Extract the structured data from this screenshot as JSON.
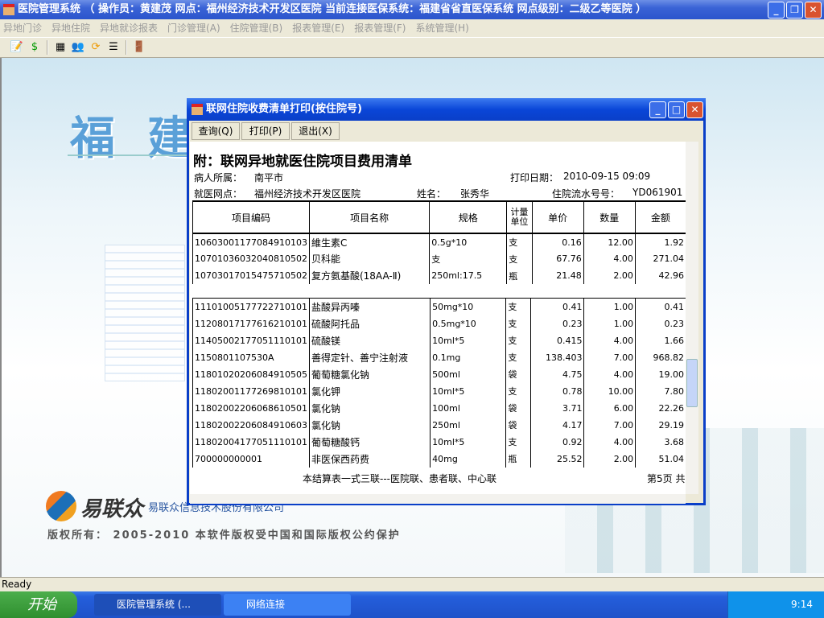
{
  "window": {
    "title": "医院管理系统 （ 操作员：黄建茂  网点：福州经济技术开发区医院    当前连接医保系统：福建省省直医保系统  网点级别：二级乙等医院 ）"
  },
  "menu": [
    "异地门诊",
    "异地住院",
    "异地就诊报表",
    "门诊管理(A)",
    "住院管理(B)",
    "报表管理(E)",
    "报表管理(F)",
    "系统管理(H)"
  ],
  "desktop": {
    "banner": "福建",
    "logo": "易联众",
    "company": "易联众信息技术股份有限公司",
    "copyright": "版权所有： 2005-2010 本软件版权受中国和国际版权公约保护"
  },
  "status": "Ready",
  "taskbar": {
    "start": "开始",
    "items": [
      "医院管理系统 (...",
      "网络连接"
    ],
    "clock": "9:14"
  },
  "dialog": {
    "title": "联网住院收费清单打印(按住院号)",
    "buttons": [
      "查询(Q)",
      "打印(P)",
      "退出(X)"
    ],
    "report": {
      "title": "附：联网异地就医住院项目费用清单",
      "patient_origin_label": "病人所属：",
      "patient_origin": "南平市",
      "print_date_label": "打印日期：",
      "print_date": "2010-09-15 09:09",
      "site_label": "就医网点：",
      "site": "福州经济技术开发区医院",
      "name_label": "姓名：",
      "name": "张秀华",
      "serial_label": "住院流水号号：",
      "serial": "YD061901",
      "columns": [
        "项目编码",
        "项目名称",
        "规格",
        "计量单位",
        "单价",
        "数量",
        "金额"
      ],
      "rows_a": [
        [
          "10603001177084910103",
          "維生素C",
          "0.5g*10",
          "支",
          "0.16",
          "12.00",
          "1.92"
        ],
        [
          "10701036032040810502",
          "贝科能",
          "支",
          "支",
          "67.76",
          "4.00",
          "271.04"
        ],
        [
          "10703017015475710502",
          "复方氨基酸(18AA-Ⅱ)",
          "250ml:17.5",
          "瓶",
          "21.48",
          "2.00",
          "42.96"
        ]
      ],
      "rows_b": [
        [
          "11101005177722710101",
          "盐酸异丙嗪",
          "50mg*10",
          "支",
          "0.41",
          "1.00",
          "0.41"
        ],
        [
          "11208017177616210101",
          "硫酸阿托品",
          "0.5mg*10",
          "支",
          "0.23",
          "1.00",
          "0.23"
        ],
        [
          "11405002177051110101",
          "硫酸镁",
          "10ml*5",
          "支",
          "0.415",
          "4.00",
          "1.66"
        ],
        [
          "1150801107530A",
          "善得定针、善宁注射液",
          "0.1mg",
          "支",
          "138.403",
          "7.00",
          "968.82"
        ],
        [
          "11801020206084910505",
          "葡萄糖氯化钠",
          "500ml",
          "袋",
          "4.75",
          "4.00",
          "19.00"
        ],
        [
          "11802001177269810101",
          "氯化钾",
          "10ml*5",
          "支",
          "0.78",
          "10.00",
          "7.80"
        ],
        [
          "11802002206068610501",
          "氯化钠",
          "100ml",
          "袋",
          "3.71",
          "6.00",
          "22.26"
        ],
        [
          "11802002206084910603",
          "氯化钠",
          "250ml",
          "袋",
          "4.17",
          "7.00",
          "29.19"
        ],
        [
          "11802004177051110101",
          "葡萄糖酸钙",
          "10ml*5",
          "支",
          "0.92",
          "4.00",
          "3.68"
        ],
        [
          "700000000001",
          "非医保西药费",
          "40mg",
          "瓶",
          "25.52",
          "2.00",
          "51.04"
        ]
      ],
      "footer": "本结算表一式三联---医院联、患者联、中心联",
      "page": "第5页  共"
    }
  }
}
